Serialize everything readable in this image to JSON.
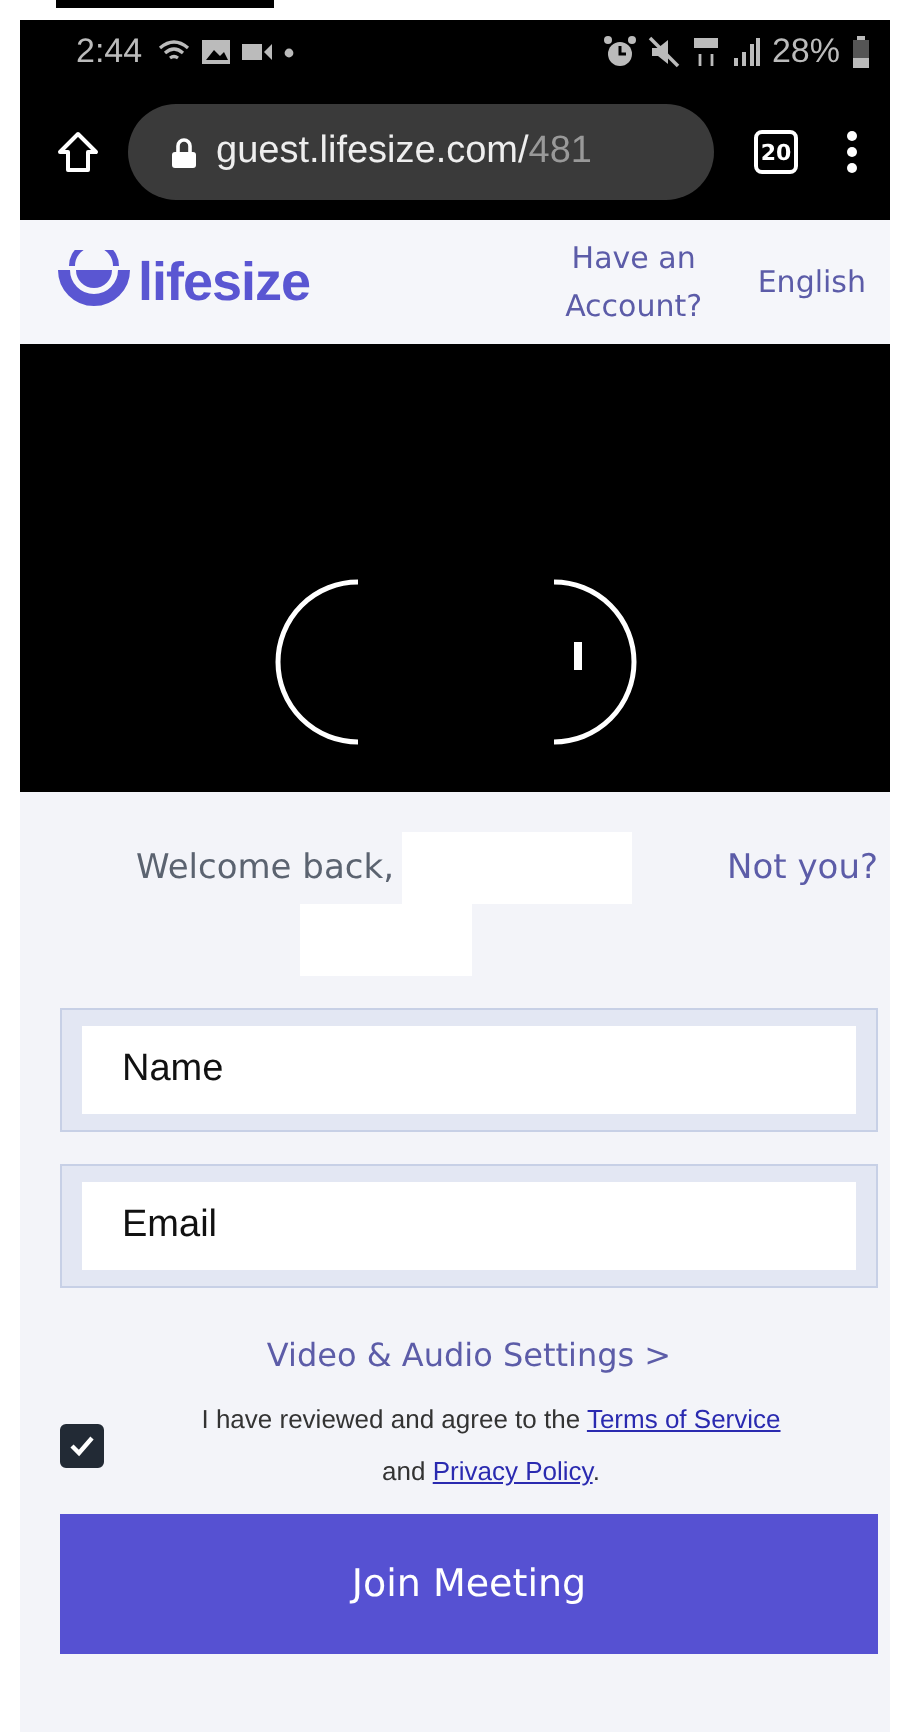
{
  "status_bar": {
    "time": "2:44",
    "battery": "28%"
  },
  "browser": {
    "url_host": "guest.lifesize.com/",
    "url_path": "481",
    "tab_count": "20"
  },
  "header": {
    "logo": "lifesize",
    "account_link": "Have an Account?",
    "language": "English"
  },
  "welcome": {
    "greeting": "Welcome back,",
    "not_you": "Not you?"
  },
  "fields": [
    {
      "placeholder": "Name"
    },
    {
      "placeholder": "Email"
    }
  ],
  "settings_link": "Video & Audio Settings >",
  "agreement": {
    "checked": true,
    "text": "I have reviewed and agree to the",
    "terms": "Terms of Service",
    "and": "and",
    "privacy": "Privacy Policy",
    "end": "."
  },
  "join_button": "Join Meeting"
}
